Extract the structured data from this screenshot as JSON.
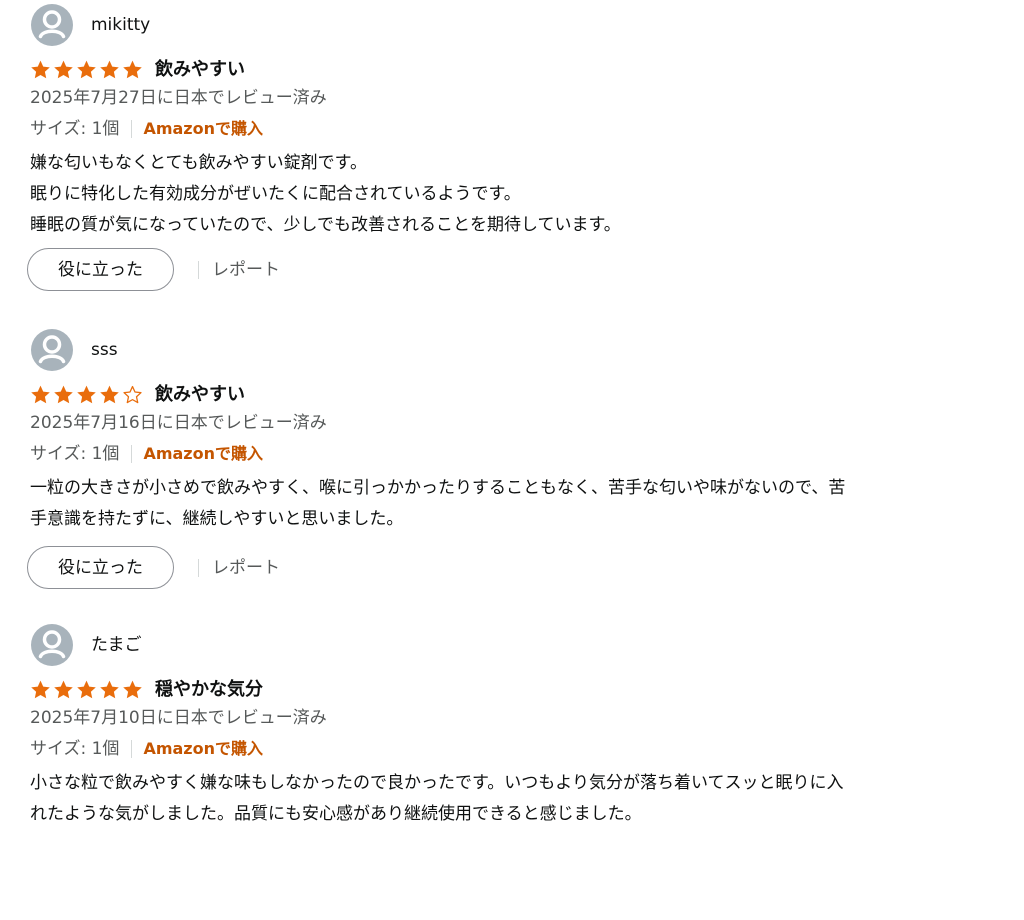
{
  "reviews": [
    {
      "author": "mikitty",
      "rating": 5,
      "title": "飲みやすい",
      "date": "2025年7月27日に日本でレビュー済み",
      "size_label": "サイズ: 1個",
      "purchase_badge": "Amazonで購入",
      "body_lines": [
        "嫌な匂いもなくとても飲みやすい錠剤です。",
        "眠りに特化した有効成分がぜいたくに配合されているようです。",
        "睡眠の質が気になっていたので、少しでも改善されることを期待しています。"
      ],
      "helpful_label": "役に立った",
      "report_label": "レポート"
    },
    {
      "author": "sss",
      "rating": 4,
      "title": "飲みやすい",
      "date": "2025年7月16日に日本でレビュー済み",
      "size_label": "サイズ: 1個",
      "purchase_badge": "Amazonで購入",
      "body_lines": [
        "一粒の大きさが小さめで飲みやすく、喉に引っかかったりすることもなく、苦手な匂いや味がないので、苦",
        "手意識を持たずに、継続しやすいと思いました。"
      ],
      "helpful_label": "役に立った",
      "report_label": "レポート"
    },
    {
      "author": "たまご",
      "rating": 5,
      "title": "穏やかな気分",
      "date": "2025年7月10日に日本でレビュー済み",
      "size_label": "サイズ: 1個",
      "purchase_badge": "Amazonで購入",
      "body_lines": [
        "小さな粒で飲みやすく嫌な味もしなかったので良かったです。いつもより気分が落ち着いてスッと眠りに入",
        "れたような気がしました。品質にも安心感があり継続使用できると感じました。"
      ]
    }
  ],
  "colors": {
    "star_filled": "#e96d0c",
    "star_empty_stroke": "#e96d0c",
    "avatar_bg": "#a8b3bb",
    "purchase_badge": "#c45500",
    "secondary_text": "#565959",
    "primary_text": "#0f1111"
  },
  "icons": {
    "avatar": "user-avatar-icon",
    "star_filled": "star-filled-icon",
    "star_empty": "star-empty-icon"
  }
}
